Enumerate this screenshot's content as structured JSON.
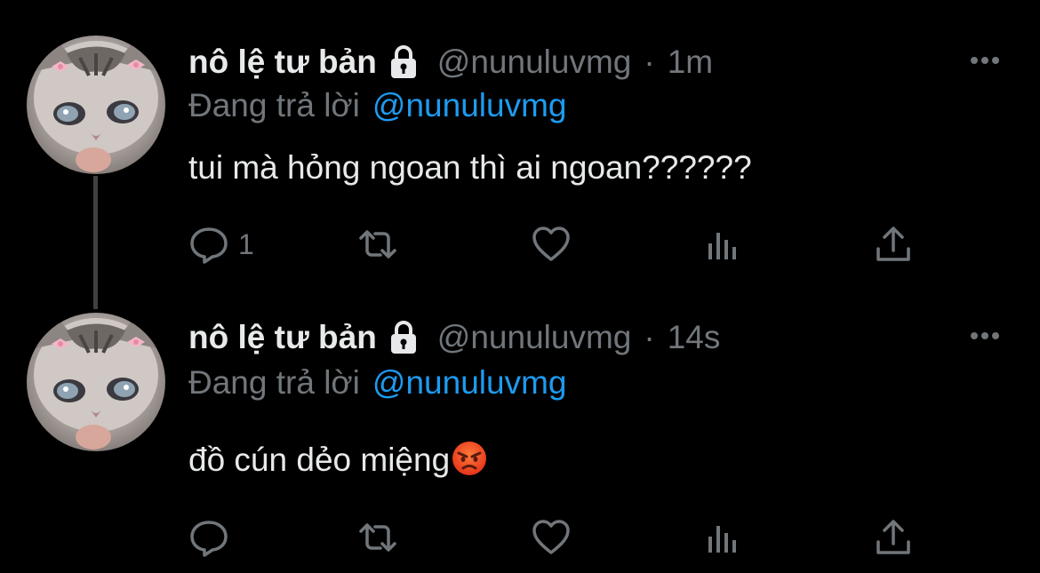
{
  "colors": {
    "background": "#000000",
    "primary_text": "#e7e9ea",
    "secondary_text": "#71767b",
    "accent": "#1d9bf0",
    "thread_line": "#3e4144"
  },
  "tweets": [
    {
      "avatar_icon": "kitten-avatar",
      "display_name": "nô lệ tư bản",
      "lock_icon": "lock-icon",
      "handle": "@nunuluvmg",
      "separator": "·",
      "time": "1m",
      "reply_prefix": "Đang trả lời",
      "reply_handle": "@nunuluvmg",
      "text": "tui mà hỏng ngoan thì ai ngoan??????",
      "emoji": "",
      "reply_count": "1",
      "more_icon": "more-horizontal-icon"
    },
    {
      "avatar_icon": "kitten-avatar",
      "display_name": "nô lệ tư bản",
      "lock_icon": "lock-icon",
      "handle": "@nunuluvmg",
      "separator": "·",
      "time": "14s",
      "reply_prefix": "Đang trả lời",
      "reply_handle": "@nunuluvmg",
      "text": "đồ cún dẻo miệng",
      "emoji": "angry-face-emoji",
      "reply_count": "",
      "more_icon": "more-horizontal-icon"
    }
  ],
  "action_icons": [
    "reply-icon",
    "retweet-icon",
    "like-icon",
    "views-icon",
    "share-icon"
  ]
}
